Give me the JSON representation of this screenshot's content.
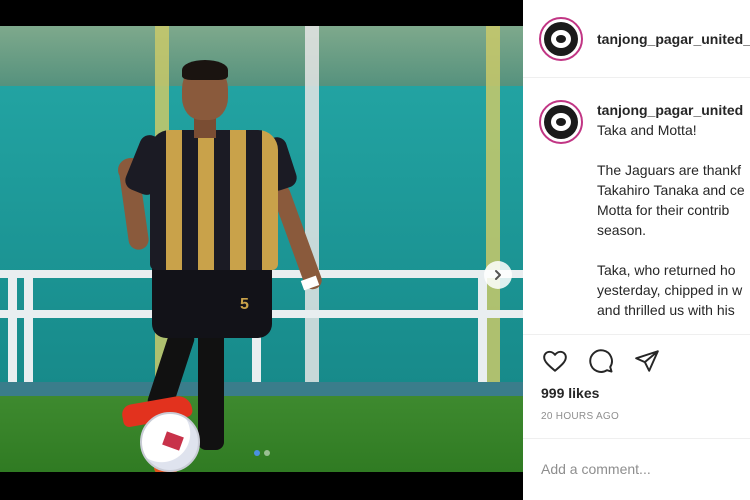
{
  "post": {
    "username": "tanjong_pagar_united_",
    "caption": {
      "username": "tanjong_pagar_united",
      "lines": [
        "Taka and Motta!",
        "",
        "The Jaguars are thankf",
        "Takahiro Tanaka and ce",
        "Motta for their contrib",
        "season.",
        "",
        "Taka, who returned ho",
        "yesterday, chipped in w",
        "and thrilled us with his"
      ]
    },
    "likes": "999 likes",
    "timestamp": "20 HOURS AGO",
    "comment_placeholder": "Add a comment...",
    "carousel": {
      "index": 1,
      "total": 2
    }
  },
  "icons": {
    "like": "heart-icon",
    "comment": "comment-icon",
    "share": "share-icon",
    "next": "chevron-right-icon"
  },
  "colors": {
    "avatar_ring": "#c13584",
    "text": "#262626",
    "muted": "#8e8e8e",
    "divider": "#efefef"
  }
}
